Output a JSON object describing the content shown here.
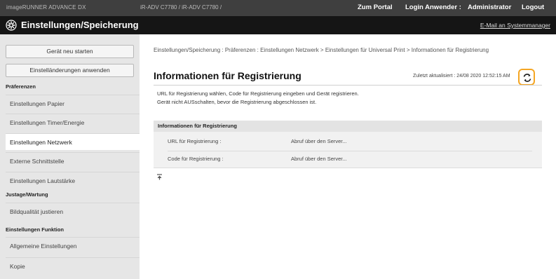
{
  "topbar": {
    "model": "imageRUNNER ADVANCE DX",
    "device": "iR-ADV C7780 / iR-ADV C7780 /",
    "portal_label": "Zum Portal",
    "login_label": "Login Anwender :",
    "user_name": "Administrator",
    "logout_label": "Logout"
  },
  "titlebar": {
    "title": "Einstellungen/Speicherung",
    "mail_label": "E-Mail an Systemmanager",
    "icon": "gear-icon"
  },
  "sidebar": {
    "restart_label": "Gerät neu starten",
    "apply_label": "Einstelländerungen anwenden",
    "sections": [
      {
        "heading": "Präferenzen"
      },
      {
        "heading": "Justage/Wartung"
      },
      {
        "heading": "Einstellungen Funktion"
      }
    ],
    "items": [
      {
        "label": "Einstellungen Papier"
      },
      {
        "label": "Einstellungen Timer/Energie"
      },
      {
        "label": "Einstellungen Netzwerk"
      },
      {
        "label": "Externe Schnittstelle"
      },
      {
        "label": "Einstellungen Lautstärke"
      },
      {
        "label": "Bildqualität justieren"
      },
      {
        "label": "Allgemeine Einstellungen"
      },
      {
        "label": "Kopie"
      }
    ],
    "active_item": "Einstellungen Netzwerk"
  },
  "main": {
    "breadcrumb": "Einstellungen/Speicherung : Präferenzen : Einstellungen Netzwerk > Einstellungen für Universal Print > Informationen für Registrierung",
    "page_title": "Informationen für Registrierung",
    "updated_label": "Zuletzt aktualisiert : 24/08 2020 12:52:15 AM",
    "refresh_icon": "refresh-icon",
    "desc_line1": "URL für Registrierung wählen, Code für Registrierung eingeben und Gerät registrieren.",
    "desc_line2": "Gerät nicht AUSschalten, bevor die Registrierung abgeschlossen ist.",
    "panel": {
      "heading": "Informationen für Registrierung",
      "rows": [
        {
          "label": "URL für Registrierung :",
          "value": "Abruf über den Server..."
        },
        {
          "label": "Code für Registrierung :",
          "value": "Abruf über den Server..."
        }
      ]
    },
    "top_icon": "back-to-top-icon"
  },
  "colors": {
    "topbar_bg": "#3f3f3f",
    "titlebar_bg": "#151515",
    "sidebar_bg": "#e6e6e6",
    "highlight": "#f5a623",
    "refresh_icon": "#1a1a1a"
  }
}
